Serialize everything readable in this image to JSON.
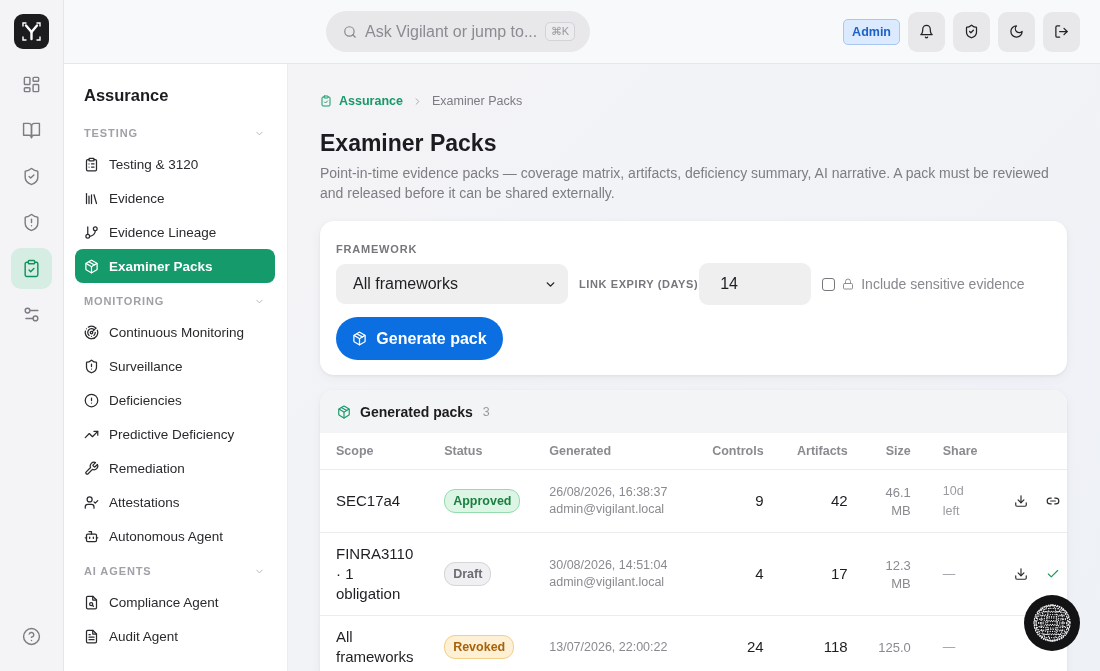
{
  "rail": {
    "items": [
      {
        "selected": false
      },
      {
        "selected": false
      },
      {
        "selected": false
      },
      {
        "selected": false
      },
      {
        "selected": true
      },
      {
        "selected": false
      }
    ]
  },
  "top_bar": {
    "search": {
      "placeholder": "Ask Vigilant or jump to...",
      "shortcut": "⌘K"
    },
    "role_badge": "Admin"
  },
  "sidebar": {
    "title": "Assurance",
    "sections": [
      {
        "label": "TESTING",
        "expanded": true,
        "items": [
          {
            "label": "Testing & 3120",
            "selected": false
          },
          {
            "label": "Evidence",
            "selected": false
          },
          {
            "label": "Evidence Lineage",
            "selected": false
          },
          {
            "label": "Examiner Packs",
            "selected": true
          }
        ]
      },
      {
        "label": "MONITORING",
        "expanded": true,
        "items": [
          {
            "label": "Continuous Monitoring",
            "selected": false
          },
          {
            "label": "Surveillance",
            "selected": false
          },
          {
            "label": "Deficiencies",
            "selected": false
          },
          {
            "label": "Predictive Deficiency",
            "selected": false
          },
          {
            "label": "Remediation",
            "selected": false
          },
          {
            "label": "Attestations",
            "selected": false
          },
          {
            "label": "Autonomous Agent",
            "selected": false
          }
        ]
      },
      {
        "label": "AI AGENTS",
        "expanded": true,
        "items": [
          {
            "label": "Compliance Agent",
            "selected": false
          },
          {
            "label": "Audit Agent",
            "selected": false
          }
        ]
      }
    ]
  },
  "breadcrumb": {
    "parent": "Assurance",
    "current": "Examiner Packs"
  },
  "page": {
    "title": "Examiner Packs",
    "description": "Point-in-time evidence packs — coverage matrix, artifacts, deficiency summary, AI narrative. A pack must be reviewed and released before it can be shared externally."
  },
  "generate_form": {
    "framework_label": "FRAMEWORK",
    "framework_value": "All frameworks",
    "expiry_label": "LINK EXPIRY (DAYS)",
    "expiry_value": "14",
    "sensitive_label": "Include sensitive evidence",
    "sensitive_checked": false,
    "submit_button": "Generate pack"
  },
  "packs": {
    "title": "Generated packs",
    "count": "3",
    "columns": [
      "Scope",
      "Status",
      "Generated",
      "Controls",
      "Artifacts",
      "Size",
      "Share"
    ],
    "rows": [
      {
        "scope": "SEC17a4",
        "status": {
          "label": "Approved",
          "kind": "approved"
        },
        "generated": "26/08/2026, 16:38:37",
        "by": "admin@vigilant.local",
        "controls": "9",
        "artifacts": "42",
        "size": "46.1 MB",
        "share": "10d left",
        "actions": [
          {
            "kind": "download"
          },
          {
            "kind": "link"
          }
        ]
      },
      {
        "scope": "FINRA3110 · 1 obligation",
        "status": {
          "label": "Draft",
          "kind": "draft"
        },
        "generated": "30/08/2026, 14:51:04",
        "by": "admin@vigilant.local",
        "controls": "4",
        "artifacts": "17",
        "size": "12.3 MB",
        "share": "—",
        "actions": [
          {
            "kind": "download"
          },
          {
            "kind": "approve"
          }
        ]
      },
      {
        "scope": "All frameworks",
        "status": {
          "label": "Revoked",
          "kind": "revoked"
        },
        "generated": "13/07/2026, 22:00:22",
        "controls": "24",
        "artifacts": "118",
        "size": "125.0",
        "share": "—"
      }
    ]
  }
}
